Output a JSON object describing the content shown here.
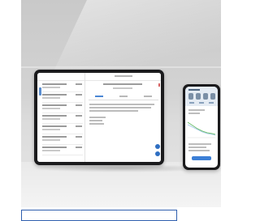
{
  "scene": {
    "devices": [
      "tablet",
      "phone"
    ]
  },
  "colors": {
    "tablet_bezel": "#1b1b1d",
    "phone_bezel": "#1a1a1c",
    "accent_blue": "#2f6fc2",
    "selection_border": "#2f5fae",
    "backdrop": "#d3d3d3"
  },
  "icons": [
    "back-chevron-icon",
    "floating-action-icon",
    "profile-avatar-icon"
  ]
}
